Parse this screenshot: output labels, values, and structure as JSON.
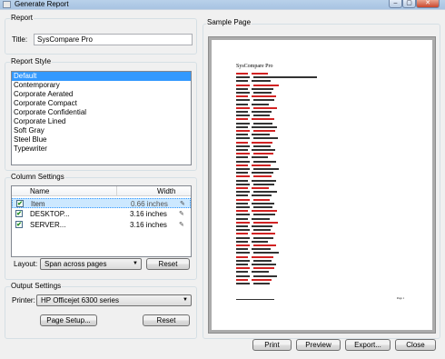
{
  "window": {
    "title": "Generate Report",
    "controls": [
      "–",
      "▢",
      "✕"
    ]
  },
  "report": {
    "legend": "Report",
    "title_label": "Title:",
    "title_value": "SysCompare Pro"
  },
  "style": {
    "legend": "Report Style",
    "items": [
      "Default",
      "Contemporary",
      "Corporate Aerated",
      "Corporate Compact",
      "Corporate Confidential",
      "Corporate Lined",
      "Soft Gray",
      "Steel Blue",
      "Typewriter"
    ],
    "selected": "Default"
  },
  "columns": {
    "legend": "Column Settings",
    "headers": {
      "name": "Name",
      "width": "Width"
    },
    "rows": [
      {
        "name": "Item",
        "width": "0.66 inches",
        "checked": true
      },
      {
        "name": "DESKTOP...",
        "width": "3.16 inches",
        "checked": true
      },
      {
        "name": "SERVER...",
        "width": "3.16 inches",
        "checked": true
      }
    ],
    "layout_label": "Layout:",
    "layout_value": "Span across pages",
    "reset_label": "Reset"
  },
  "output": {
    "legend": "Output Settings",
    "printer_label": "Printer:",
    "printer_value": "HP Officejet 6300 series",
    "page_setup_label": "Page Setup...",
    "reset_label": "Reset"
  },
  "sample": {
    "legend": "Sample Page",
    "page_title": "SysCompare Pro",
    "page_number": "Page 1"
  },
  "footer": {
    "print": "Print",
    "preview": "Preview",
    "export": "Export...",
    "close": "Close"
  },
  "colors": {
    "accent": "#3399ff",
    "red_text": "#d22222"
  }
}
